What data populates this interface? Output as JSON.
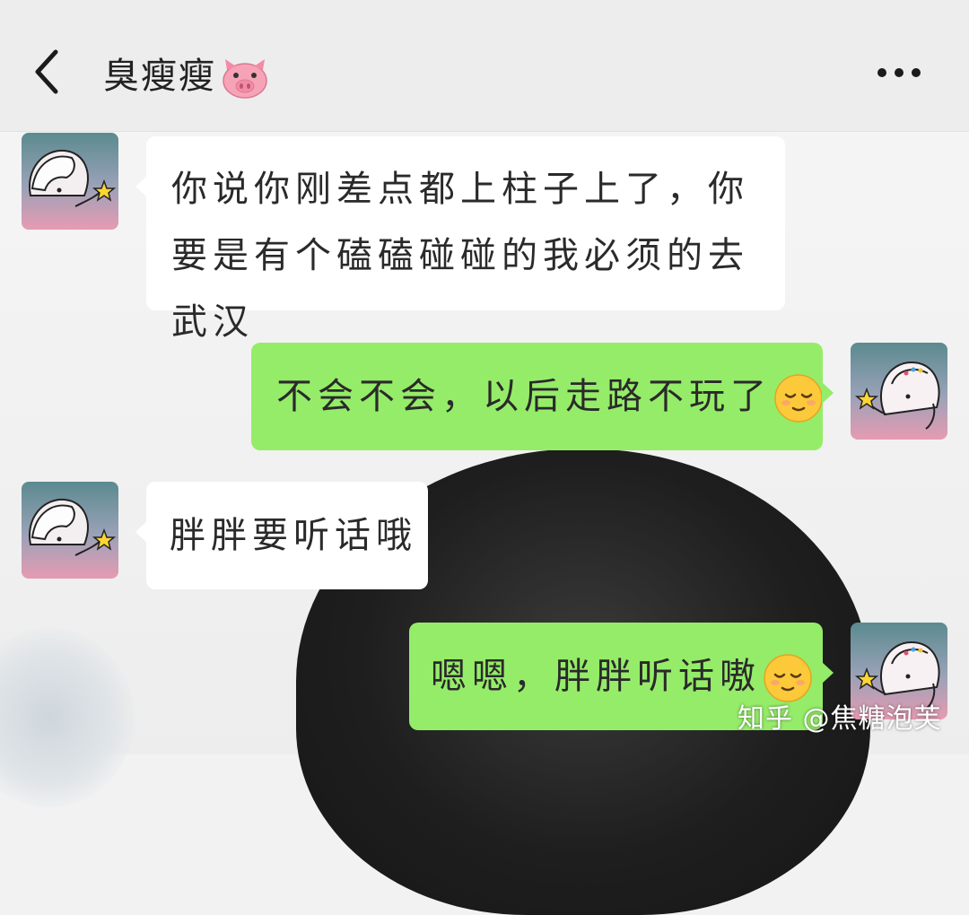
{
  "header": {
    "title": "臭瘦瘦",
    "title_emoji": "pig-face-icon",
    "back_icon": "chevron-left-icon",
    "more_icon": "more-horizontal-icon"
  },
  "messages": [
    {
      "side": "left",
      "text": "你说你刚差点都上柱子上了，你要是有个磕磕碰碰的我必须的去武汉"
    },
    {
      "side": "right",
      "text": "不会不会，以后走路不玩了",
      "emoji": "relieved-face-icon"
    },
    {
      "side": "left",
      "text": "胖胖要听话哦"
    },
    {
      "side": "right",
      "text": "嗯嗯，胖胖听话嗷",
      "emoji": "relieved-face-icon"
    }
  ],
  "watermark": "知乎 @焦糖泡芙",
  "colors": {
    "header_bg": "#ededed",
    "incoming_bubble": "#ffffff",
    "outgoing_bubble": "#95ec69",
    "text": "#2a2a2a"
  }
}
